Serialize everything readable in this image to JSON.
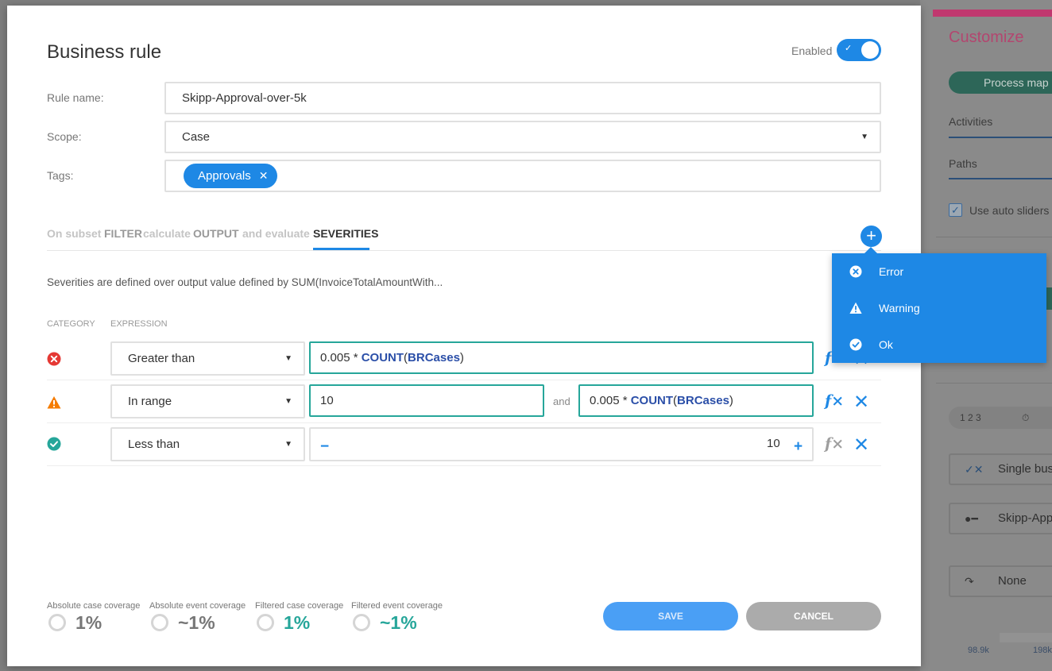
{
  "background": {
    "title": "Customize",
    "pill": "Process map",
    "tabs": [
      "Activities",
      "Paths"
    ],
    "checkbox_label": "Use auto sliders s",
    "segment": [
      "1 2 3",
      "⏱"
    ],
    "boxes": [
      "Single busi",
      "Skipp-App",
      "None"
    ],
    "axis": [
      "98.9k",
      "198k"
    ]
  },
  "dialog": {
    "title": "Business rule",
    "enabled_label": "Enabled",
    "enabled": true,
    "fields": {
      "rule_name_label": "Rule name:",
      "rule_name_value": "Skipp-Approval-over-5k",
      "scope_label": "Scope:",
      "scope_value": "Case",
      "tags_label": "Tags:",
      "tag_chip": "Approvals"
    },
    "tabs": {
      "on_subset": "On subset",
      "filter": "FILTER",
      "calculate": "calculate",
      "output": "OUTPUT",
      "and_evaluate": "and evaluate",
      "severities": "SEVERITIES"
    },
    "description": "Severities are defined over output value defined by SUM(InvoiceTotalAmountWith...",
    "columns": {
      "category": "CATEGORY",
      "expression": "EXPRESSION"
    },
    "rows": [
      {
        "severity": "error",
        "operator": "Greater than",
        "expr_prefix": "0.005 * ",
        "expr_fn": "COUNT",
        "expr_open": "(",
        "expr_arg": "BRCases",
        "expr_close": ")"
      },
      {
        "severity": "warning",
        "operator": "In range",
        "low": "10",
        "and": "and",
        "expr_prefix": "0.005 * ",
        "expr_fn": "COUNT",
        "expr_open": "(",
        "expr_arg": "BRCases",
        "expr_close": ")"
      },
      {
        "severity": "ok",
        "operator": "Less than",
        "minus": "−",
        "value": "10",
        "plus": "+"
      }
    ],
    "fx_label": "f",
    "coverage": [
      {
        "label": "Absolute case coverage",
        "value": "1%",
        "color": "#777777"
      },
      {
        "label": "Absolute event coverage",
        "value": "~1%",
        "color": "#777777"
      },
      {
        "label": "Filtered case coverage",
        "value": "1%",
        "color": "#26a69a"
      },
      {
        "label": "Filtered event coverage",
        "value": "~1%",
        "color": "#26a69a"
      }
    ],
    "buttons": {
      "save": "SAVE",
      "cancel": "CANCEL"
    }
  },
  "menu": {
    "items": [
      {
        "label": "Error",
        "icon": "error-icon"
      },
      {
        "label": "Warning",
        "icon": "warning-icon"
      },
      {
        "label": "Ok",
        "icon": "ok-icon"
      }
    ]
  },
  "colors": {
    "accent": "#1e88e5",
    "teal": "#26a69a",
    "error": "#e53935",
    "warning": "#f57c00",
    "ok": "#26a69a"
  }
}
